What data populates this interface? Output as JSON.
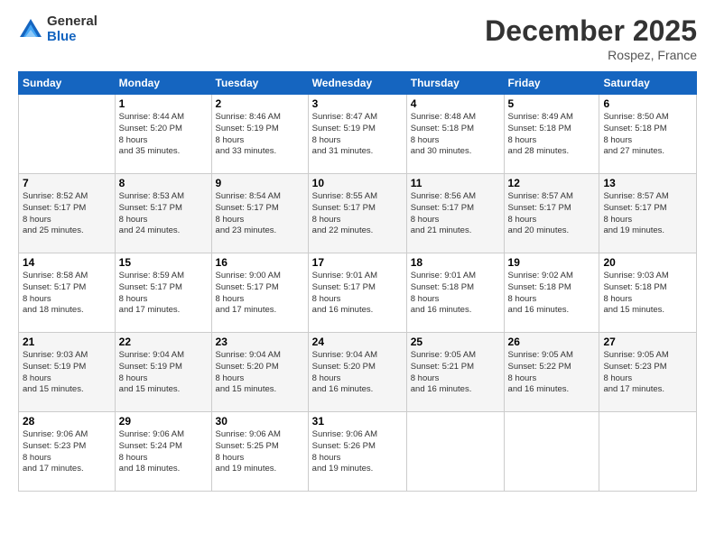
{
  "logo": {
    "general": "General",
    "blue": "Blue"
  },
  "title": "December 2025",
  "location": "Rospez, France",
  "days_of_week": [
    "Sunday",
    "Monday",
    "Tuesday",
    "Wednesday",
    "Thursday",
    "Friday",
    "Saturday"
  ],
  "weeks": [
    [
      {
        "day": "",
        "sunrise": "",
        "sunset": "",
        "daylight": ""
      },
      {
        "day": "1",
        "sunrise": "Sunrise: 8:44 AM",
        "sunset": "Sunset: 5:20 PM",
        "daylight": "Daylight: 8 hours and 35 minutes."
      },
      {
        "day": "2",
        "sunrise": "Sunrise: 8:46 AM",
        "sunset": "Sunset: 5:19 PM",
        "daylight": "Daylight: 8 hours and 33 minutes."
      },
      {
        "day": "3",
        "sunrise": "Sunrise: 8:47 AM",
        "sunset": "Sunset: 5:19 PM",
        "daylight": "Daylight: 8 hours and 31 minutes."
      },
      {
        "day": "4",
        "sunrise": "Sunrise: 8:48 AM",
        "sunset": "Sunset: 5:18 PM",
        "daylight": "Daylight: 8 hours and 30 minutes."
      },
      {
        "day": "5",
        "sunrise": "Sunrise: 8:49 AM",
        "sunset": "Sunset: 5:18 PM",
        "daylight": "Daylight: 8 hours and 28 minutes."
      },
      {
        "day": "6",
        "sunrise": "Sunrise: 8:50 AM",
        "sunset": "Sunset: 5:18 PM",
        "daylight": "Daylight: 8 hours and 27 minutes."
      }
    ],
    [
      {
        "day": "7",
        "sunrise": "Sunrise: 8:52 AM",
        "sunset": "Sunset: 5:17 PM",
        "daylight": "Daylight: 8 hours and 25 minutes."
      },
      {
        "day": "8",
        "sunrise": "Sunrise: 8:53 AM",
        "sunset": "Sunset: 5:17 PM",
        "daylight": "Daylight: 8 hours and 24 minutes."
      },
      {
        "day": "9",
        "sunrise": "Sunrise: 8:54 AM",
        "sunset": "Sunset: 5:17 PM",
        "daylight": "Daylight: 8 hours and 23 minutes."
      },
      {
        "day": "10",
        "sunrise": "Sunrise: 8:55 AM",
        "sunset": "Sunset: 5:17 PM",
        "daylight": "Daylight: 8 hours and 22 minutes."
      },
      {
        "day": "11",
        "sunrise": "Sunrise: 8:56 AM",
        "sunset": "Sunset: 5:17 PM",
        "daylight": "Daylight: 8 hours and 21 minutes."
      },
      {
        "day": "12",
        "sunrise": "Sunrise: 8:57 AM",
        "sunset": "Sunset: 5:17 PM",
        "daylight": "Daylight: 8 hours and 20 minutes."
      },
      {
        "day": "13",
        "sunrise": "Sunrise: 8:57 AM",
        "sunset": "Sunset: 5:17 PM",
        "daylight": "Daylight: 8 hours and 19 minutes."
      }
    ],
    [
      {
        "day": "14",
        "sunrise": "Sunrise: 8:58 AM",
        "sunset": "Sunset: 5:17 PM",
        "daylight": "Daylight: 8 hours and 18 minutes."
      },
      {
        "day": "15",
        "sunrise": "Sunrise: 8:59 AM",
        "sunset": "Sunset: 5:17 PM",
        "daylight": "Daylight: 8 hours and 17 minutes."
      },
      {
        "day": "16",
        "sunrise": "Sunrise: 9:00 AM",
        "sunset": "Sunset: 5:17 PM",
        "daylight": "Daylight: 8 hours and 17 minutes."
      },
      {
        "day": "17",
        "sunrise": "Sunrise: 9:01 AM",
        "sunset": "Sunset: 5:17 PM",
        "daylight": "Daylight: 8 hours and 16 minutes."
      },
      {
        "day": "18",
        "sunrise": "Sunrise: 9:01 AM",
        "sunset": "Sunset: 5:18 PM",
        "daylight": "Daylight: 8 hours and 16 minutes."
      },
      {
        "day": "19",
        "sunrise": "Sunrise: 9:02 AM",
        "sunset": "Sunset: 5:18 PM",
        "daylight": "Daylight: 8 hours and 16 minutes."
      },
      {
        "day": "20",
        "sunrise": "Sunrise: 9:03 AM",
        "sunset": "Sunset: 5:18 PM",
        "daylight": "Daylight: 8 hours and 15 minutes."
      }
    ],
    [
      {
        "day": "21",
        "sunrise": "Sunrise: 9:03 AM",
        "sunset": "Sunset: 5:19 PM",
        "daylight": "Daylight: 8 hours and 15 minutes."
      },
      {
        "day": "22",
        "sunrise": "Sunrise: 9:04 AM",
        "sunset": "Sunset: 5:19 PM",
        "daylight": "Daylight: 8 hours and 15 minutes."
      },
      {
        "day": "23",
        "sunrise": "Sunrise: 9:04 AM",
        "sunset": "Sunset: 5:20 PM",
        "daylight": "Daylight: 8 hours and 15 minutes."
      },
      {
        "day": "24",
        "sunrise": "Sunrise: 9:04 AM",
        "sunset": "Sunset: 5:20 PM",
        "daylight": "Daylight: 8 hours and 16 minutes."
      },
      {
        "day": "25",
        "sunrise": "Sunrise: 9:05 AM",
        "sunset": "Sunset: 5:21 PM",
        "daylight": "Daylight: 8 hours and 16 minutes."
      },
      {
        "day": "26",
        "sunrise": "Sunrise: 9:05 AM",
        "sunset": "Sunset: 5:22 PM",
        "daylight": "Daylight: 8 hours and 16 minutes."
      },
      {
        "day": "27",
        "sunrise": "Sunrise: 9:05 AM",
        "sunset": "Sunset: 5:23 PM",
        "daylight": "Daylight: 8 hours and 17 minutes."
      }
    ],
    [
      {
        "day": "28",
        "sunrise": "Sunrise: 9:06 AM",
        "sunset": "Sunset: 5:23 PM",
        "daylight": "Daylight: 8 hours and 17 minutes."
      },
      {
        "day": "29",
        "sunrise": "Sunrise: 9:06 AM",
        "sunset": "Sunset: 5:24 PM",
        "daylight": "Daylight: 8 hours and 18 minutes."
      },
      {
        "day": "30",
        "sunrise": "Sunrise: 9:06 AM",
        "sunset": "Sunset: 5:25 PM",
        "daylight": "Daylight: 8 hours and 19 minutes."
      },
      {
        "day": "31",
        "sunrise": "Sunrise: 9:06 AM",
        "sunset": "Sunset: 5:26 PM",
        "daylight": "Daylight: 8 hours and 19 minutes."
      },
      {
        "day": "",
        "sunrise": "",
        "sunset": "",
        "daylight": ""
      },
      {
        "day": "",
        "sunrise": "",
        "sunset": "",
        "daylight": ""
      },
      {
        "day": "",
        "sunrise": "",
        "sunset": "",
        "daylight": ""
      }
    ]
  ]
}
